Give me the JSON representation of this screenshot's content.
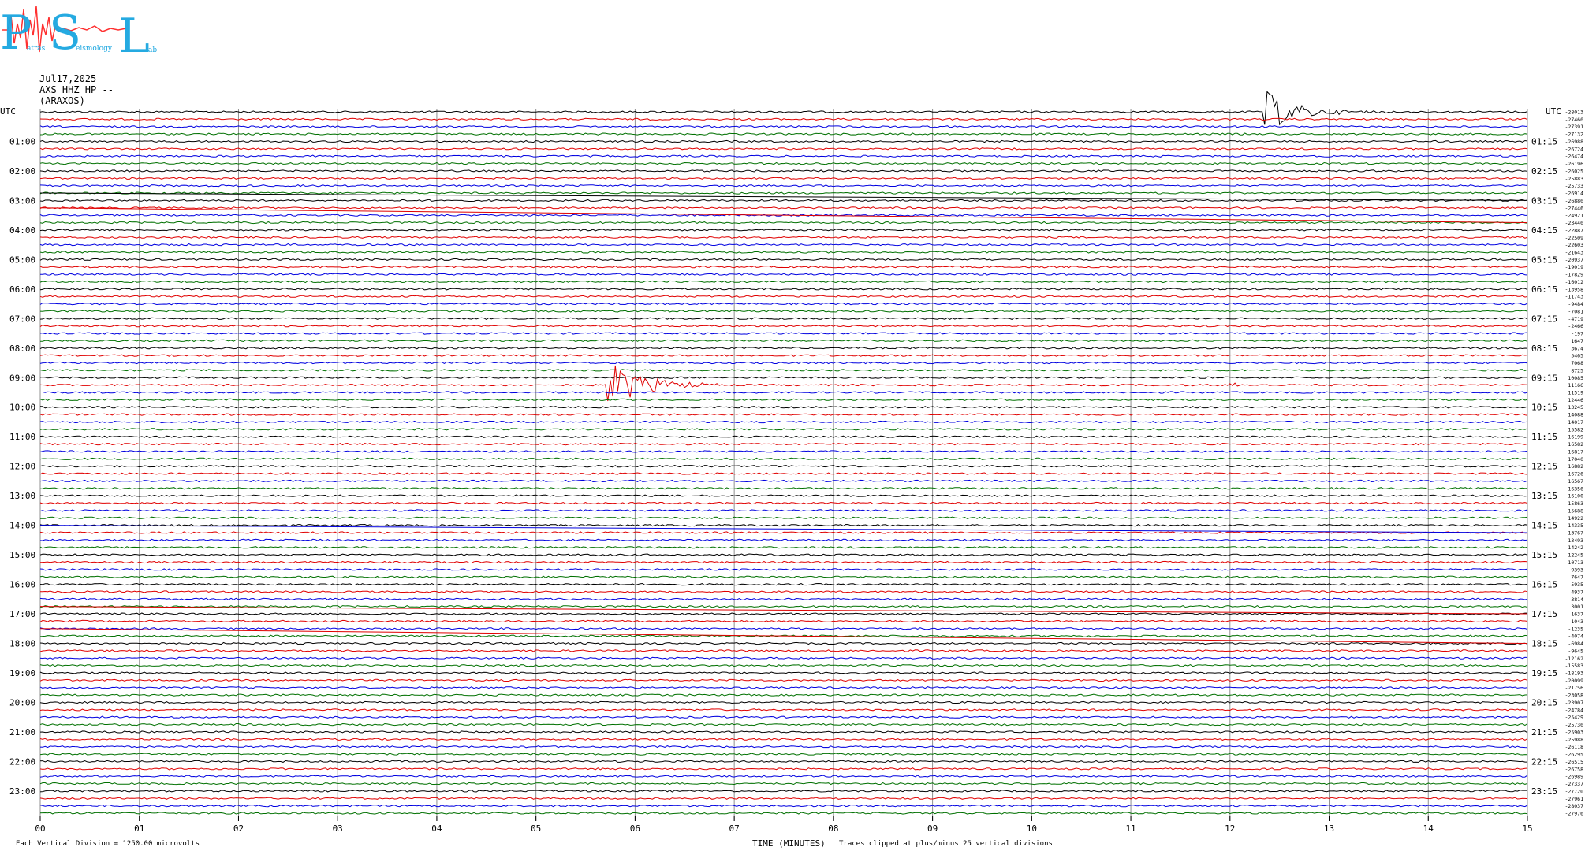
{
  "header": {
    "date": "Jul17,2025",
    "station": "AXS HHZ HP --",
    "site": "(ARAXOS)",
    "logo_letters": [
      "P",
      "S",
      "L"
    ],
    "logo_words": [
      "atras",
      "eismology",
      "ab"
    ]
  },
  "footer": {
    "left_note": "Each Vertical Division = 1250.00 microvolts",
    "xlabel": "TIME (MINUTES)",
    "clip_note": "Traces clipped at plus/minus 25 vertical divisions"
  },
  "colors": {
    "trace_cycle": [
      "#000000",
      "#e00000",
      "#0000e0",
      "#007000"
    ],
    "logo_primary": "#1aa6e0",
    "logo_accent": "#ff3030",
    "grid": "#909090"
  },
  "chart_data": {
    "type": "line",
    "title": "",
    "xlabel": "TIME (MINUTES)",
    "xlim": [
      0,
      15
    ],
    "x_ticks": [
      "00",
      "01",
      "02",
      "03",
      "04",
      "05",
      "06",
      "07",
      "08",
      "09",
      "10",
      "11",
      "12",
      "13",
      "14",
      "15"
    ],
    "lines_per_hour": 4,
    "minutes_per_line": 15,
    "left_axis_label": "UTC",
    "right_axis_label": "UTC",
    "left_hour_labels": [
      "01:00",
      "02:00",
      "03:00",
      "04:00",
      "05:00",
      "06:00",
      "07:00",
      "08:00",
      "09:00",
      "10:00",
      "11:00",
      "12:00",
      "13:00",
      "14:00",
      "15:00",
      "16:00",
      "17:00",
      "18:00",
      "19:00",
      "20:00",
      "21:00",
      "22:00",
      "23:00"
    ],
    "right_hour_labels": [
      "01:15",
      "02:15",
      "03:15",
      "04:15",
      "05:15",
      "06:15",
      "07:15",
      "08:15",
      "09:15",
      "10:15",
      "11:15",
      "12:15",
      "13:15",
      "14:15",
      "15:15",
      "16:15",
      "17:15",
      "18:15",
      "19:15",
      "20:15",
      "21:15",
      "22:15",
      "23:15"
    ],
    "line_offsets": [
      -28013,
      -27460,
      -27391,
      -27132,
      -26988,
      -26724,
      -26474,
      -26196,
      -26025,
      -25883,
      -25733,
      -26914,
      -26880,
      -27446,
      -24921,
      -23440,
      -22887,
      -22509,
      -22603,
      -21643,
      -20937,
      -19019,
      -17829,
      -16012,
      -13958,
      -11743,
      -9484,
      -7081,
      -4719,
      -2466,
      -197,
      1647,
      3674,
      5465,
      7068,
      8725,
      10085,
      11166,
      11519,
      12446,
      13245,
      14088,
      14017,
      15582,
      16199,
      16582,
      16817,
      17040,
      16882,
      16726,
      16567,
      16356,
      16100,
      15863,
      15688,
      14922,
      14335,
      13767,
      13493,
      14242,
      12245,
      10713,
      9393,
      7647,
      5935,
      4937,
      3814,
      3001,
      1637,
      1043,
      -1235,
      -4074,
      -6984,
      -9645,
      -12162,
      -15583,
      -18193,
      -20099,
      -21756,
      -23058,
      -23907,
      -24784,
      -25429,
      -25730,
      -25903,
      -25988,
      -26118,
      -26295,
      -26515,
      -26758,
      -26989,
      -27337,
      -27720,
      -27961,
      -28037,
      -27976
    ],
    "events": [
      {
        "line": 0,
        "minute_start": 12.35,
        "minute_end": 13.6,
        "peak_divisions": 3.0
      },
      {
        "line": 37,
        "minute_start": 5.7,
        "minute_end": 7.0,
        "peak_divisions": 4.0
      },
      {
        "line": 37,
        "minute_start": 12.0,
        "minute_end": 12.15,
        "peak_divisions": 0.8
      }
    ],
    "drift_segments": [
      {
        "from_line": 11,
        "to_line": 12,
        "color_index": 0
      },
      {
        "from_line": 13,
        "to_line": 15,
        "color_index": 1
      },
      {
        "from_line": 56,
        "to_line": 57,
        "color_index": 2
      },
      {
        "from_line": 67,
        "to_line": 68,
        "color_index": 1
      },
      {
        "from_line": 70,
        "to_line": 72,
        "color_index": 1
      }
    ]
  }
}
